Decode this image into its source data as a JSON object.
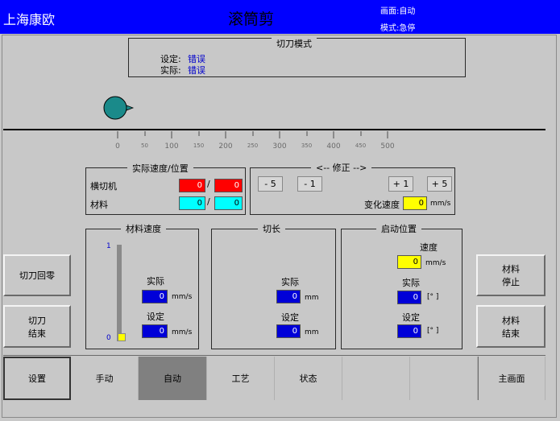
{
  "header": {
    "brand": "上海康欧",
    "title": "滚筒剪",
    "screen_label": "画面:自动",
    "mode_label": "模式:急停"
  },
  "cutter_mode": {
    "title": "切刀模式",
    "set_label": "设定:",
    "set_value": "错误",
    "actual_label": "实际:",
    "actual_value": "错误"
  },
  "scale": {
    "major": [
      "0",
      "100",
      "200",
      "300",
      "400",
      "500"
    ],
    "minor": [
      "50",
      "150",
      "250",
      "350",
      "450"
    ]
  },
  "actual_speed": {
    "title": "实际速度/位置",
    "cutter_label": "横切机",
    "cutter_speed": "0",
    "cutter_pos": "0",
    "material_label": "材料",
    "material_speed": "0",
    "material_pos": "0",
    "separator": "/"
  },
  "correction": {
    "title": "<-- 修正 -->",
    "minus5": "- 5",
    "minus1": "- 1",
    "plus1": "+ 1",
    "plus5": "+ 5",
    "change_speed_label": "变化速度",
    "change_speed_value": "0",
    "unit": "mm/s"
  },
  "material_speed": {
    "title": "材料速度",
    "bar_max": "1",
    "bar_min": "0",
    "bar_level": 0,
    "actual_label": "实际",
    "actual_value": "0",
    "set_label": "设定",
    "set_value": "0",
    "unit": "mm/s"
  },
  "cut_length": {
    "title": "切长",
    "actual_label": "实际",
    "actual_value": "0",
    "set_label": "设定",
    "set_value": "0",
    "unit": "mm"
  },
  "start_position": {
    "title": "启动位置",
    "speed_label": "速度",
    "speed_value": "0",
    "speed_unit": "mm/s",
    "actual_label": "实际",
    "actual_value": "0",
    "actual_unit": "[° ]",
    "set_label": "设定",
    "set_value": "0",
    "set_unit": "[° ]"
  },
  "side_buttons": {
    "cutter_home": "切刀回零",
    "cutter_end": "切刀\n结束",
    "material_stop": "材料\n停止",
    "material_end": "材料\n结束"
  },
  "tabs": [
    "设置",
    "手动",
    "自动",
    "工艺",
    "状态",
    "",
    "",
    "主画面"
  ],
  "colors": {
    "header_bg": "#0000ff",
    "active_tab": "#808080",
    "blue_field": "#0000d8",
    "red_field": "#ff0000",
    "cyan_field": "#00ffff",
    "yellow_field": "#ffff00",
    "roll_color": "#1a8a8a"
  }
}
